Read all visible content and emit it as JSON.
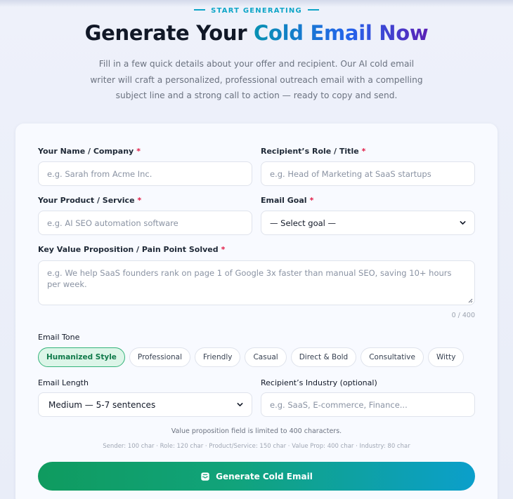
{
  "header": {
    "eyebrow": "START GENERATING",
    "title_plain": "Generate Your",
    "title_accent": "Cold Email Now",
    "subtitle": "Fill in a few quick details about your offer and recipient. Our AI cold email writer will craft a personalized, professional outreach email with a compelling subject line and a strong call to action — ready to copy and send."
  },
  "form": {
    "sender": {
      "label": "Your Name / Company",
      "required": "*",
      "placeholder": "e.g. Sarah from Acme Inc.",
      "value": ""
    },
    "recipient_role": {
      "label": "Recipient’s Role / Title",
      "required": "*",
      "placeholder": "e.g. Head of Marketing at SaaS startups",
      "value": ""
    },
    "product": {
      "label": "Your Product / Service",
      "required": "*",
      "placeholder": "e.g. AI SEO automation software",
      "value": ""
    },
    "goal": {
      "label": "Email Goal",
      "required": "*",
      "selected": "— Select goal —"
    },
    "value_prop": {
      "label": "Key Value Proposition / Pain Point Solved",
      "required": "*",
      "placeholder": "e.g. We help SaaS founders rank on page 1 of Google 3x faster than manual SEO, saving 10+ hours per week.",
      "counter": "0 / 400"
    },
    "tone": {
      "label": "Email Tone",
      "options": [
        "Humanized Style",
        "Professional",
        "Friendly",
        "Casual",
        "Direct & Bold",
        "Consultative",
        "Witty"
      ],
      "selected": "Humanized Style"
    },
    "length": {
      "label": "Email Length",
      "selected": "Medium — 5-7 sentences"
    },
    "industry": {
      "label": "Recipient’s Industry (optional)",
      "placeholder": "e.g. SaaS, E-commerce, Finance...",
      "value": ""
    },
    "limit_note": "Value proposition field is limited to 400 characters.",
    "limits_detail": "Sender: 100 char · Role: 120 char · Product/Service: 150 char · Value Prop: 400 char · Industry: 80 char",
    "submit_label": "Generate Cold Email"
  },
  "colors": {
    "accent_cyan": "#0ea5c7",
    "required": "#e11d48",
    "active_chip_bg": "#dcf5e8",
    "active_chip_text": "#0f7a4a",
    "button_start": "#0f9b5f",
    "button_end": "#0b9fcb"
  },
  "icons": {
    "submit": "email-inbox-icon",
    "select": "chevron-down-icon"
  }
}
